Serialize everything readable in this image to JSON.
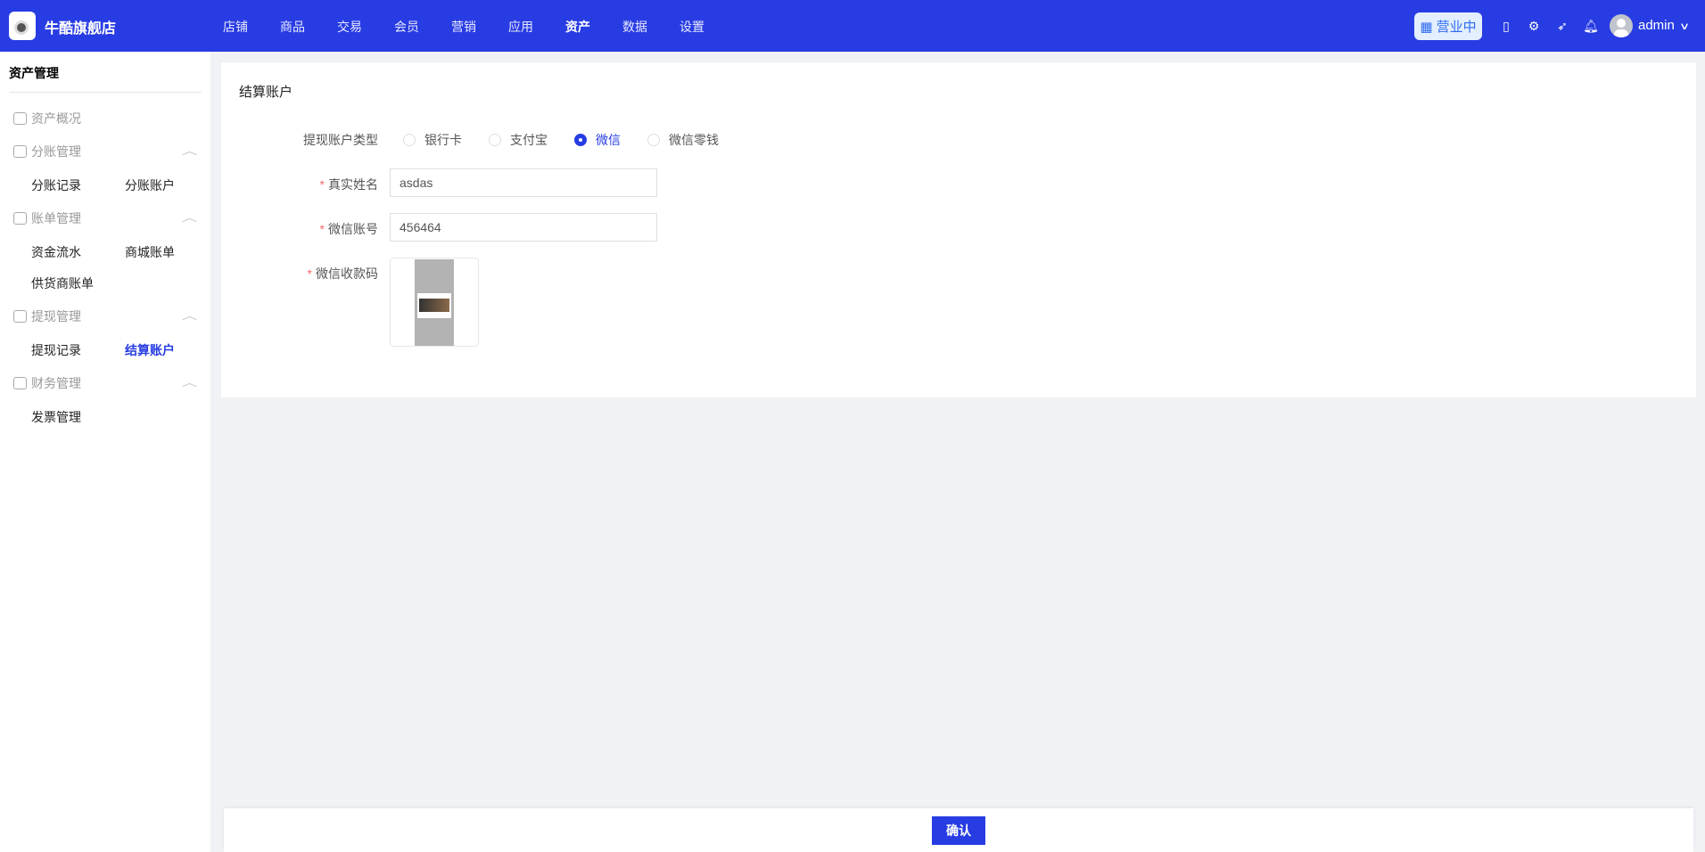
{
  "header": {
    "store_name": "牛酷旗舰店",
    "nav": [
      "店铺",
      "商品",
      "交易",
      "会员",
      "营销",
      "应用",
      "资产",
      "数据",
      "设置"
    ],
    "active_nav": "资产",
    "status": "营业中",
    "user": "admin"
  },
  "sidebar": {
    "title": "资产管理",
    "overview": "资产概况",
    "groups": [
      {
        "label": "分账管理",
        "items": [
          "分账记录",
          "分账账户"
        ]
      },
      {
        "label": "账单管理",
        "items": [
          "资金流水",
          "商城账单",
          "供货商账单"
        ]
      },
      {
        "label": "提现管理",
        "items": [
          "提现记录",
          "结算账户"
        ]
      },
      {
        "label": "财务管理",
        "items": [
          "发票管理"
        ]
      }
    ],
    "active": "结算账户"
  },
  "form": {
    "title": "结算账户",
    "type_label": "提现账户类型",
    "types": [
      "银行卡",
      "支付宝",
      "微信",
      "微信零钱"
    ],
    "selected_type": "微信",
    "name_label": "真实姓名",
    "name_value": "asdas",
    "account_label": "微信账号",
    "account_value": "456464",
    "qr_label": "微信收款码",
    "required_mark": "*"
  },
  "footer": {
    "confirm": "确认"
  },
  "colors": {
    "primary": "#283ce3",
    "required": "#f56c6c"
  }
}
